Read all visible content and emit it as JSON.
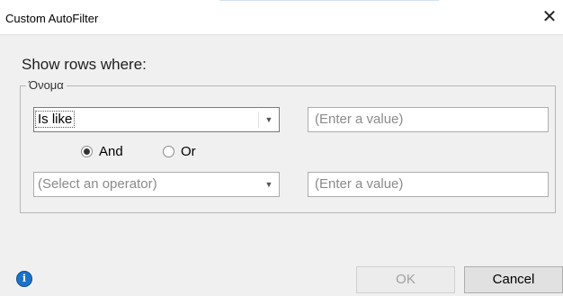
{
  "window": {
    "title": "Custom AutoFilter",
    "close_symbol": "✕"
  },
  "filter": {
    "heading": "Show rows where:",
    "column_name": "Όνομα",
    "condition1": {
      "operator": "Is like",
      "value_placeholder": "(Enter a value)"
    },
    "logic": {
      "and_label": "And",
      "or_label": "Or",
      "selected": "And"
    },
    "condition2": {
      "operator_placeholder": "(Select an operator)",
      "value_placeholder": "(Enter a value)"
    }
  },
  "footer": {
    "info_icon": "i",
    "ok_label": "OK",
    "cancel_label": "Cancel"
  }
}
